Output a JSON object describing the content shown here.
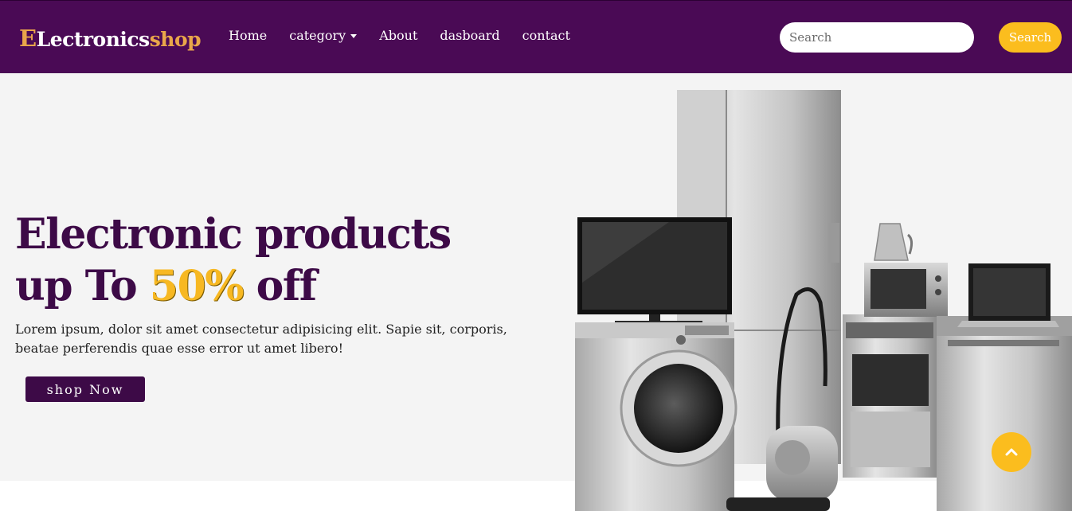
{
  "brand": {
    "part1": "E",
    "part2": "Lectronics",
    "part3": "shop"
  },
  "nav": {
    "home": "Home",
    "category": "category",
    "about": "About",
    "dashboard": "dasboard",
    "contact": "contact"
  },
  "search": {
    "placeholder": "Search",
    "button_label": "Search"
  },
  "hero": {
    "line1": "Electronic products",
    "line2_prefix": "up To ",
    "highlight": "50%",
    "line2_suffix": " off",
    "description": "Lorem ipsum, dolor sit amet consectetur adipisicing elit. Sapie sit, corporis, beatae perferendis quae esse error ut amet libero!",
    "cta_label": "shop Now"
  },
  "colors": {
    "navbar_bg": "#4a0a55",
    "brand_accent": "#e9a64a",
    "accent_yellow": "#fbbd1e",
    "headline": "#3d0a47",
    "hero_bg": "#f4f4f4"
  },
  "icons": {
    "scroll_top": "chevron-up-icon",
    "dropdown": "caret-down-icon"
  }
}
